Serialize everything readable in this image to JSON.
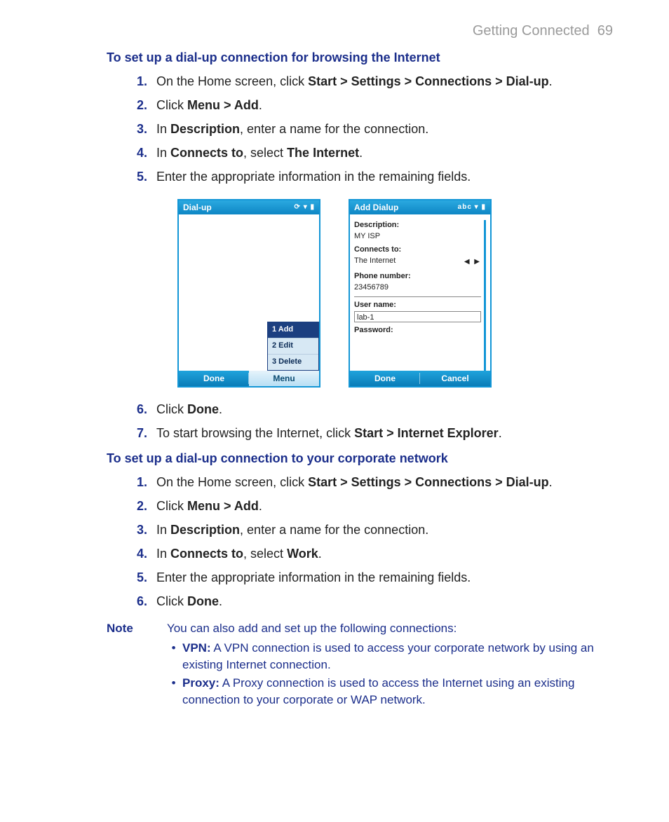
{
  "header": {
    "chapter": "Getting Connected",
    "page": "69"
  },
  "sec1": {
    "title": "To set up a dial-up connection for browsing the Internet",
    "steps": {
      "s1a": "On the Home screen, click ",
      "s1b": "Start > Settings > Connections > Dial-up",
      "s1c": ".",
      "s2a": "Click ",
      "s2b": "Menu > Add",
      "s2c": ".",
      "s3a": "In ",
      "s3b": "Description",
      "s3c": ", enter a name for the connection.",
      "s4a": "In ",
      "s4b": "Connects to",
      "s4c": ", select ",
      "s4d": "The Internet",
      "s4e": ".",
      "s5": "Enter the appropriate information in the remaining fields.",
      "s6a": "Click ",
      "s6b": "Done",
      "s6c": ".",
      "s7a": "To start browsing the Internet, click ",
      "s7b": "Start > Internet Explorer",
      "s7c": "."
    }
  },
  "deviceA": {
    "title": "Dial-up",
    "menu1": "1 Add",
    "menu2": "2 Edit",
    "menu3": "3 Delete",
    "softLeft": "Done",
    "softRight": "Menu"
  },
  "deviceB": {
    "title": "Add Dialup",
    "titleRight": "abc",
    "descLabel": "Description:",
    "descValue": "MY ISP",
    "connLabel": "Connects to:",
    "connValue": "The Internet",
    "phoneLabel": "Phone number:",
    "phoneValue": "23456789",
    "userLabel": "User name:",
    "userValue": "lab-1",
    "passLabel": "Password:",
    "softLeft": "Done",
    "softRight": "Cancel"
  },
  "sec2": {
    "title": "To set up a dial-up connection to your corporate network",
    "steps": {
      "s1a": "On the Home screen, click ",
      "s1b": "Start > Settings > Connections > Dial-up",
      "s1c": ".",
      "s2a": "Click ",
      "s2b": "Menu > Add",
      "s2c": ".",
      "s3a": "In ",
      "s3b": "Description",
      "s3c": ", enter a name for the connection.",
      "s4a": "In ",
      "s4b": "Connects to",
      "s4c": ", select ",
      "s4d": "Work",
      "s4e": ".",
      "s5": "Enter the appropriate information in the remaining fields.",
      "s6a": "Click ",
      "s6b": "Done",
      "s6c": "."
    }
  },
  "note": {
    "label": "Note",
    "intro": "You can also add and set up the following connections:",
    "vpnLabel": "VPN:",
    "vpnText": " A VPN connection is used to access your corporate network by using an existing Internet connection.",
    "proxyLabel": "Proxy:",
    "proxyText": " A Proxy connection is used to access the Internet using an existing connection to your corporate or WAP network."
  }
}
